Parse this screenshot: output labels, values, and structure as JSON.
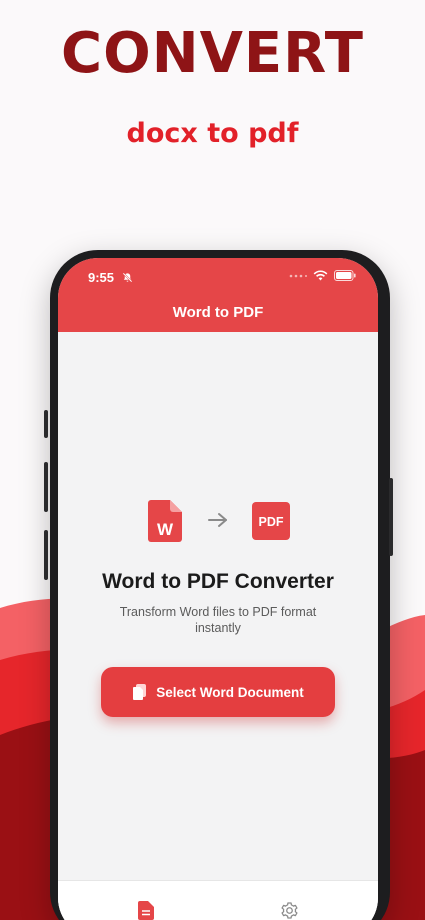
{
  "promo": {
    "headline": "CONVERT",
    "subhead": "docx to pdf"
  },
  "status_bar": {
    "time": "9:55",
    "icons": [
      "bell-slash-icon",
      "signal-dots-icon",
      "wifi-icon",
      "battery-icon"
    ]
  },
  "app_bar": {
    "title": "Word to PDF"
  },
  "conversion_graphic": {
    "source_icon": "word-file-icon",
    "source_letter": "W",
    "arrow_icon": "arrow-right-icon",
    "target_icon": "pdf-file-icon",
    "target_label": "PDF"
  },
  "main": {
    "title": "Word to PDF Converter",
    "description": "Transform Word files to PDF format instantly",
    "button_label": "Select Word Document",
    "button_icon": "document-icon"
  },
  "tab_bar": {
    "tabs": [
      {
        "icon": "document-icon",
        "active": true
      },
      {
        "icon": "gear-icon",
        "active": false
      }
    ]
  },
  "colors": {
    "brand_dark": "#8e1416",
    "brand_red": "#e22129",
    "app_bar": "#e54648",
    "button": "#e43e40"
  }
}
